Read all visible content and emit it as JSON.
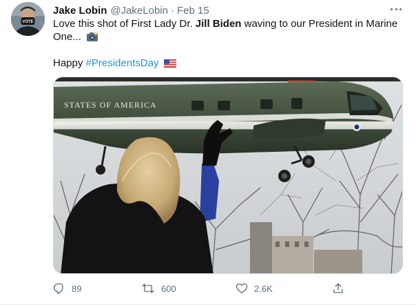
{
  "tweet": {
    "display_name": "Jake Lobin",
    "handle": "@JakeLobin",
    "separator": "·",
    "timestamp": "Feb 15",
    "text_line1_a": "Love this shot of First Lady Dr. ",
    "text_line1_bold": "Jill Biden",
    "text_line1_b": " waving to our President in Marine",
    "text_line2": "One...",
    "text_line3_a": "Happy ",
    "hashtag": "#PresidentsDay",
    "avatar_badge_text": "VOTE",
    "image_text": "STATES OF AMERICA"
  },
  "actions": {
    "reply_count": "89",
    "retweet_count": "600",
    "like_count": "2.6K"
  },
  "icons": {
    "camera": "camera-flash-emoji",
    "flag": "us-flag-emoji",
    "more": "more-icon",
    "reply": "reply-icon",
    "retweet": "retweet-icon",
    "like": "like-icon",
    "share": "share-icon"
  },
  "colors": {
    "link": "#1b95e0",
    "secondary_text": "#5b7083",
    "primary_text": "#0f1419"
  }
}
